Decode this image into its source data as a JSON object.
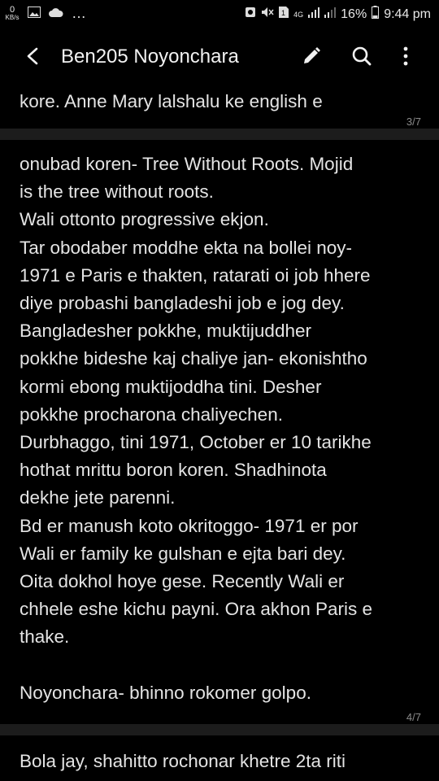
{
  "status_bar": {
    "kbs_value": "0",
    "kbs_unit": "KB/s",
    "dots": "…",
    "network": "4G",
    "battery": "16%",
    "time": "9:44 pm"
  },
  "toolbar": {
    "title": "Ben205 Noyonchara"
  },
  "pages": {
    "prev_tail": "kore. Anne Mary lalshalu ke english e",
    "prev_page_num": "3/7",
    "current_text": "onubad koren- Tree Without Roots. Mojid\nis the tree without roots.\nWali ottonto progressive ekjon.\nTar obodaber moddhe ekta na bollei noy-\n1971 e Paris e thakten, ratarati oi job hhere\ndiye probashi bangladeshi job e jog dey.\nBangladesher pokkhe, muktijuddher\npokkhe bideshe kaj chaliye jan- ekonishtho\nkormi ebong muktijoddha tini. Desher\npokkhe procharona chaliyechen.\nDurbhaggo, tini 1971, October er 10 tarikhe\nhothat mrittu boron koren. Shadhinota\ndekhe jete parenni.\nBd er manush koto okritoggo- 1971 er por\nWali er family ke gulshan e ejta bari dey.\nOita dokhol hoye gese. Recently Wali er\nchhele eshe kichu payni. Ora akhon Paris e\nthake.\n\nNoyonchara- bhinno rokomer golpo.",
    "current_page_num": "4/7",
    "next_head": "Bola jay, shahitto rochonar khetre 2ta riti"
  }
}
